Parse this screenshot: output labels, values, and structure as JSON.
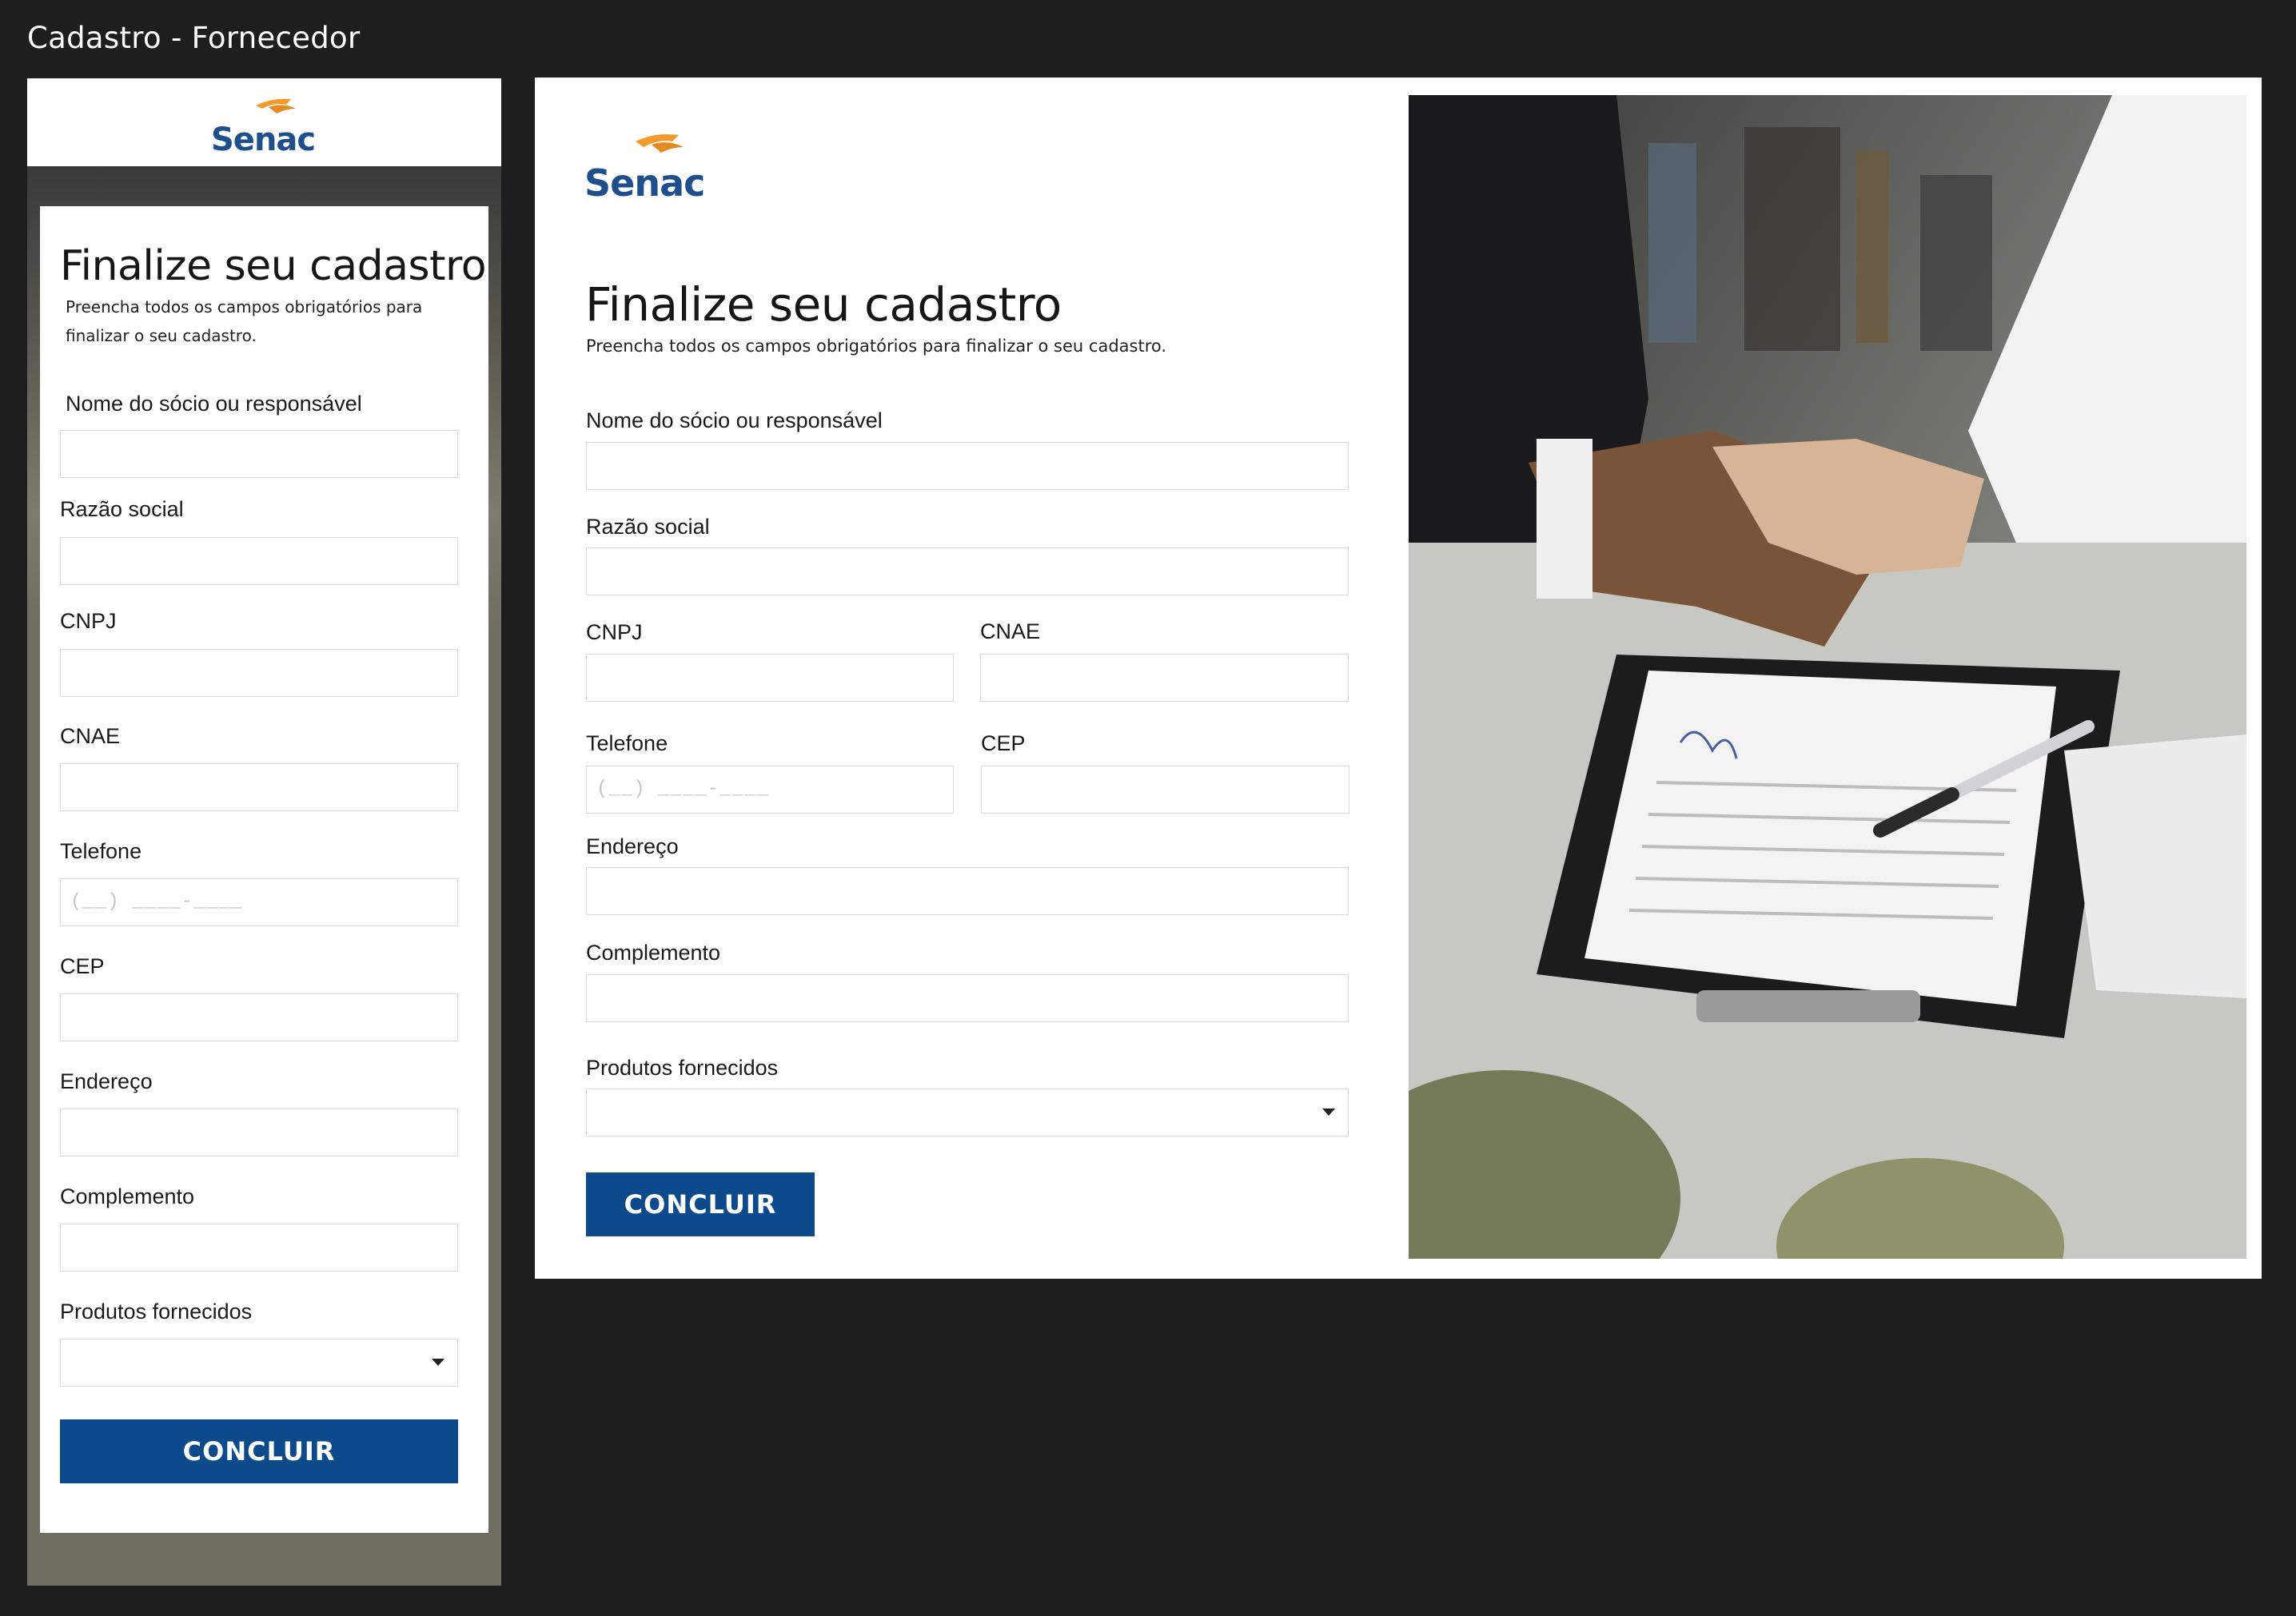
{
  "frame": {
    "title": "Cadastro - Fornecedor"
  },
  "brand": {
    "name": "Senac",
    "primary_color": "#0d4a8c",
    "accent_color": "#f39a2e"
  },
  "form": {
    "title": "Finalize seu cadastro",
    "subtitle_mobile": "Preencha todos os campos obrigatórios para finalizar o seu cadastro.",
    "subtitle_desktop": "Preencha todos os campos obrigatórios para finalizar o seu cadastro.",
    "fields": {
      "nome": {
        "label": "Nome do sócio ou responsável",
        "value": ""
      },
      "razao": {
        "label": "Razão social",
        "value": ""
      },
      "cnpj": {
        "label": "CNPJ",
        "value": ""
      },
      "cnae": {
        "label": "CNAE",
        "value": ""
      },
      "telefone": {
        "label": "Telefone",
        "value": "",
        "placeholder": "(__) ____-____"
      },
      "cep": {
        "label": "CEP",
        "value": ""
      },
      "endereco": {
        "label": "Endereço",
        "value": ""
      },
      "complemento": {
        "label": "Complemento",
        "value": ""
      },
      "produtos": {
        "label": "Produtos fornecidos",
        "selected": ""
      }
    },
    "submit_label": "CONCLUIR"
  },
  "hero_image": {
    "subject": "handshake-over-contract-photo"
  }
}
